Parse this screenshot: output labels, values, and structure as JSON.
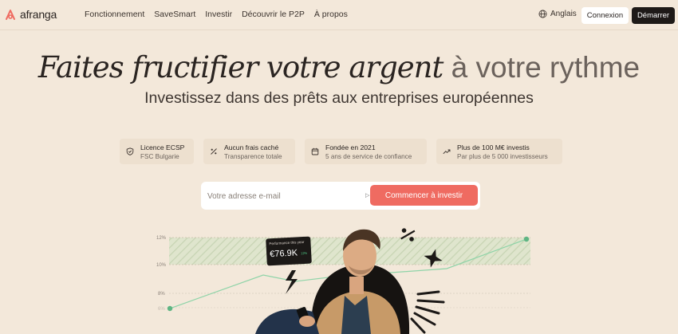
{
  "brand": {
    "name": "afranga"
  },
  "nav": {
    "items": [
      {
        "label": "Fonctionnement",
        "id": "fonctionnement"
      },
      {
        "label": "SaveSmart",
        "id": "savesmart"
      },
      {
        "label": "Investir",
        "id": "investir"
      },
      {
        "label": "Découvrir le P2P",
        "id": "decouvrir-p2p"
      },
      {
        "label": "À propos",
        "id": "a-propos"
      }
    ],
    "language": "Anglais",
    "login": "Connexion",
    "start": "Démarrer"
  },
  "hero": {
    "title_italic": "Faites fructifier votre argent",
    "title_plain": "à votre rythme",
    "subtitle": "Investissez dans des prêts aux entreprises européennes"
  },
  "features": [
    {
      "title": "Licence ECSP",
      "subtitle": "FSC Bulgarie",
      "icon": "shield-icon"
    },
    {
      "title": "Aucun frais caché",
      "subtitle": "Transparence totale",
      "icon": "percent-icon"
    },
    {
      "title": "Fondée en 2021",
      "subtitle": "5 ans de service de confiance",
      "icon": "calendar-icon"
    },
    {
      "title": "Plus de 100 M€ investis",
      "subtitle": "Par plus de 5 000 investisseurs",
      "icon": "trend-up-icon"
    }
  ],
  "signup": {
    "email_placeholder": "Votre adresse e-mail",
    "cta": "Commencer à investir"
  },
  "illustration": {
    "y_ticks": [
      "12%",
      "10%",
      "8%",
      "6%"
    ],
    "performance_label": "Performance this year",
    "performance_value": "€76.9K",
    "performance_badge": "12%"
  },
  "colors": {
    "background": "#f3e8da",
    "accent": "#ef6b61",
    "dark": "#1e1a18",
    "chart_line": "#8fd4a8"
  }
}
